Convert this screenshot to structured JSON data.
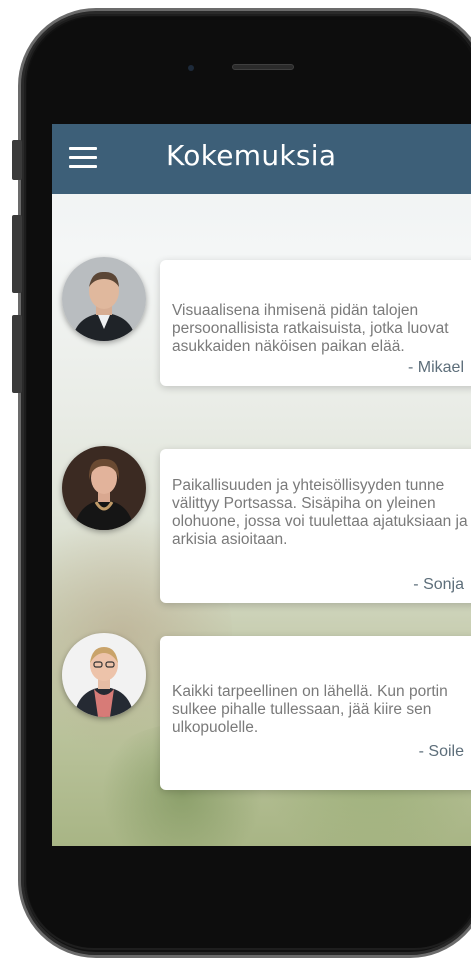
{
  "header": {
    "title": "Kokemuksia",
    "menu_icon": "hamburger-menu-icon"
  },
  "colors": {
    "appbar": "#3d5f78",
    "card_text": "#7a7a7a",
    "author_text": "#5d6e7a"
  },
  "testimonials": [
    {
      "quote": "Visuaalisena ihmisenä pidän talojen persoonallisista ratkaisuista, jotka luovat asukkaiden näköisen paikan elää.",
      "author": "- Mikael"
    },
    {
      "quote": "Paikallisuuden ja yhteisöllisyyden tunne välittyy Portsassa. Sisäpiha on yleinen olohuone, jossa voi tuulettaa ajatuksiaan ja arkisia asioitaan.",
      "author": "- Sonja"
    },
    {
      "quote": "Kaikki tarpeellinen on lähellä. Kun portin sulkee pihalle tullessaan, jää kiire sen ulkopuolelle.",
      "author": "- Soile"
    }
  ]
}
